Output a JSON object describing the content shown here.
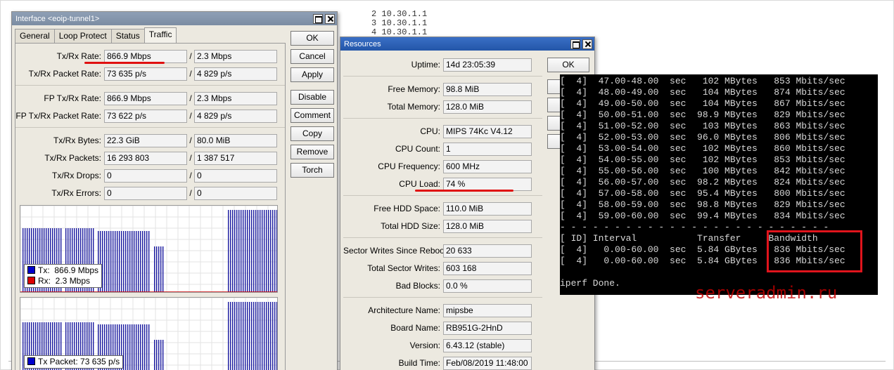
{
  "background_lines": [
    "2 10.30.1.1",
    "3 10.30.1.1",
    "4 10.30.1.1"
  ],
  "interface_window": {
    "title": "Interface <eoip-tunnel1>",
    "tabs": [
      "General",
      "Loop Protect",
      "Status",
      "Traffic"
    ],
    "active_tab": "Traffic",
    "fields": [
      {
        "label": "Tx/Rx Rate:",
        "tx": "866.9 Mbps",
        "rx": "2.3 Mbps"
      },
      {
        "label": "Tx/Rx Packet Rate:",
        "tx": "73 635 p/s",
        "rx": "4 829 p/s"
      },
      {
        "label": "FP Tx/Rx Rate:",
        "tx": "866.9 Mbps",
        "rx": "2.3 Mbps"
      },
      {
        "label": "FP Tx/Rx Packet Rate:",
        "tx": "73 622 p/s",
        "rx": "4 829 p/s"
      },
      {
        "label": "Tx/Rx Bytes:",
        "tx": "22.3 GiB",
        "rx": "80.0 MiB"
      },
      {
        "label": "Tx/Rx Packets:",
        "tx": "16 293 803",
        "rx": "1 387 517"
      },
      {
        "label": "Tx/Rx Drops:",
        "tx": "0",
        "rx": "0"
      },
      {
        "label": "Tx/Rx Errors:",
        "tx": "0",
        "rx": "0"
      }
    ],
    "slash": "/",
    "buttons": [
      "OK",
      "Cancel",
      "Apply",
      "Disable",
      "Comment",
      "Copy",
      "Remove",
      "Torch"
    ],
    "graph1_legend": [
      {
        "label": "Tx:",
        "value": "866.9 Mbps",
        "color": "#0000cc"
      },
      {
        "label": "Rx:",
        "value": "2.3 Mbps",
        "color": "#dd0000"
      }
    ],
    "graph2_legend_partial": "Tx Packet: 73 635 p/s"
  },
  "resources_window": {
    "title": "Resources",
    "ok_button": "OK",
    "groups": [
      [
        {
          "label": "Uptime:",
          "value": "14d 23:05:39"
        }
      ],
      [
        {
          "label": "Free Memory:",
          "value": "98.8 MiB"
        },
        {
          "label": "Total Memory:",
          "value": "128.0 MiB"
        }
      ],
      [
        {
          "label": "CPU:",
          "value": "MIPS 74Kc V4.12"
        },
        {
          "label": "CPU Count:",
          "value": "1"
        },
        {
          "label": "CPU Frequency:",
          "value": "600 MHz"
        },
        {
          "label": "CPU Load:",
          "value": "74 %"
        }
      ],
      [
        {
          "label": "Free HDD Space:",
          "value": "110.0 MiB"
        },
        {
          "label": "Total HDD Size:",
          "value": "128.0 MiB"
        }
      ],
      [
        {
          "label": "Sector Writes Since Reboot:",
          "value": "20 633"
        },
        {
          "label": "Total Sector Writes:",
          "value": "603 168"
        },
        {
          "label": "Bad Blocks:",
          "value": "0.0 %"
        }
      ],
      [
        {
          "label": "Architecture Name:",
          "value": "mipsbe"
        },
        {
          "label": "Board Name:",
          "value": "RB951G-2HnD"
        },
        {
          "label": "Version:",
          "value": "6.43.12 (stable)"
        },
        {
          "label": "Build Time:",
          "value": "Feb/08/2019 11:48:00"
        }
      ]
    ]
  },
  "terminal": {
    "lines": [
      "[  4]  47.00-48.00  sec   102 MBytes   853 Mbits/sec",
      "[  4]  48.00-49.00  sec   104 MBytes   874 Mbits/sec",
      "[  4]  49.00-50.00  sec   104 MBytes   867 Mbits/sec",
      "[  4]  50.00-51.00  sec  98.9 MBytes   829 Mbits/sec",
      "[  4]  51.00-52.00  sec   103 MBytes   863 Mbits/sec",
      "[  4]  52.00-53.00  sec  96.0 MBytes   806 Mbits/sec",
      "[  4]  53.00-54.00  sec   102 MBytes   860 Mbits/sec",
      "[  4]  54.00-55.00  sec   102 MBytes   853 Mbits/sec",
      "[  4]  55.00-56.00  sec   100 MBytes   842 Mbits/sec",
      "[  4]  56.00-57.00  sec  98.2 MBytes   824 Mbits/sec",
      "[  4]  57.00-58.00  sec  95.4 MBytes   800 Mbits/sec",
      "[  4]  58.00-59.00  sec  98.8 MBytes   829 Mbits/sec",
      "[  4]  59.00-60.00  sec  99.4 MBytes   834 Mbits/sec",
      "- - - - - - - - - - - - - - - - - - - - - - - - -",
      "[ ID] Interval           Transfer     Bandwidth",
      "[  4]   0.00-60.00  sec  5.84 GBytes   836 Mbits/sec",
      "[  4]   0.00-60.00  sec  5.84 GBytes   836 Mbits/sec",
      "",
      "iperf Done."
    ]
  },
  "watermark": "serveradmin.ru",
  "colors": {
    "highlight": "#e0141c",
    "terminal_bg": "#000000",
    "tx_series": "#1a1aa0",
    "rx_series": "#cc0000"
  }
}
